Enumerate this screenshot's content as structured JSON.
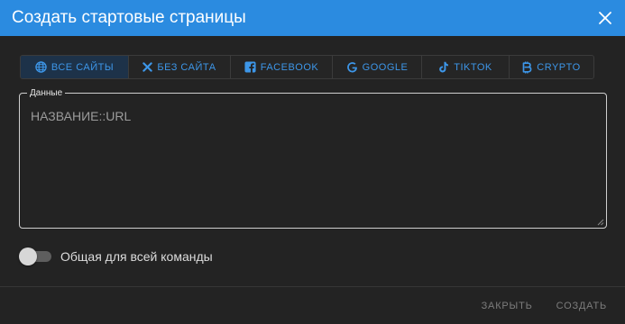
{
  "dialog": {
    "title": "Создать стартовые страницы",
    "close_icon": "close-icon"
  },
  "tabs": [
    {
      "label": "Все сайты",
      "icon": "globe-icon",
      "active": true
    },
    {
      "label": "Без сайта",
      "icon": "x-icon",
      "active": false
    },
    {
      "label": "Facebook",
      "icon": "facebook-icon",
      "active": false
    },
    {
      "label": "Google",
      "icon": "google-icon",
      "active": false
    },
    {
      "label": "Tiktok",
      "icon": "tiktok-icon",
      "active": false
    },
    {
      "label": "Crypto",
      "icon": "bitcoin-icon",
      "active": false
    }
  ],
  "data_field": {
    "legend": "Данные",
    "placeholder": "НАЗВАНИЕ::URL"
  },
  "team_toggle": {
    "label": "Общая для всей команды",
    "checked": false
  },
  "footer": {
    "close_label": "Закрыть",
    "create_label": "Создать"
  },
  "colors": {
    "accent": "#2b8be0",
    "tab_text": "#3d96e8",
    "background": "#232323"
  }
}
